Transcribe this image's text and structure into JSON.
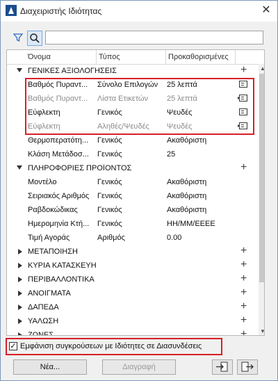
{
  "window": {
    "title": "Διαχειριστής Ιδιότητας"
  },
  "search": {
    "placeholder": ""
  },
  "columns": [
    "Όνομα",
    "Τύπος",
    "Προκαθορισμένες"
  ],
  "rows": [
    {
      "kind": "group",
      "expanded": true,
      "name": "ΓΕΝΙΚΕΣ ΑΞΙΟΛΟΓΗΣΕΙΣ"
    },
    {
      "kind": "item",
      "name": "Βαθμός Πυραντ...",
      "type": "Σύνολο Επιλογών",
      "default": "25 λεπτά",
      "dim": false,
      "icon": "list-icon"
    },
    {
      "kind": "item",
      "name": "Βαθμός Πυραντ...",
      "type": "Λίστα Ετικετών",
      "default": "25 λεπτά",
      "dim": true,
      "icon": "list-link-icon"
    },
    {
      "kind": "item",
      "name": "Εύφλεκτη",
      "type": "Γενικός",
      "default": "Ψευδές",
      "dim": false,
      "icon": "list-icon"
    },
    {
      "kind": "item",
      "name": "Εύφλεκτη",
      "type": "Αληθές/Ψευδές",
      "default": "Ψευδές",
      "dim": true,
      "icon": "list-link-icon"
    },
    {
      "kind": "item",
      "name": "Θερμοπερατότη...",
      "type": "Γενικός",
      "default": "Ακαθόριστη",
      "dim": false,
      "icon": ""
    },
    {
      "kind": "item",
      "name": "Κλάση Μετάδοσ...",
      "type": "Γενικός",
      "default": "25",
      "dim": false,
      "icon": ""
    },
    {
      "kind": "group",
      "expanded": true,
      "name": "ΠΛΗΡΟΦΟΡΙΕΣ ΠΡΟΪΟΝΤΟΣ"
    },
    {
      "kind": "item",
      "name": "Μοντέλο",
      "type": "Γενικός",
      "default": "Ακαθόριστη",
      "dim": false,
      "icon": ""
    },
    {
      "kind": "item",
      "name": "Σειριακός Αριθμός",
      "type": "Γενικός",
      "default": "Ακαθόριστη",
      "dim": false,
      "icon": ""
    },
    {
      "kind": "item",
      "name": "Ραβδοκώδικας",
      "type": "Γενικός",
      "default": "Ακαθόριστη",
      "dim": false,
      "icon": ""
    },
    {
      "kind": "item",
      "name": "Ημερομηνία Κτή...",
      "type": "Γενικός",
      "default": "HH/MM/EEEE",
      "dim": false,
      "icon": ""
    },
    {
      "kind": "item",
      "name": "Τιμή Αγοράς",
      "type": "Αριθμός",
      "default": "0.00",
      "dim": false,
      "icon": ""
    },
    {
      "kind": "group",
      "expanded": false,
      "name": "ΜΕΤΑΠΟΙΗΣΗ"
    },
    {
      "kind": "group",
      "expanded": false,
      "name": "ΚΥΡΙΑ ΚΑΤΑΣΚΕΥΗ"
    },
    {
      "kind": "group",
      "expanded": false,
      "name": "ΠΕΡΙΒΑΛΛΟΝΤΙΚΑ"
    },
    {
      "kind": "group",
      "expanded": false,
      "name": "ΑΝΟΙΓΜΑΤΑ"
    },
    {
      "kind": "group",
      "expanded": false,
      "name": "ΔΑΠΕΔΑ"
    },
    {
      "kind": "group",
      "expanded": false,
      "name": "ΥΑΛΩΣΗ"
    },
    {
      "kind": "group",
      "expanded": false,
      "name": "ΖΩΝΕΣ"
    }
  ],
  "checkbox": {
    "label": "Εμφάνιση συγκρούσεων με Ιδιότητες σε Διασυνδέσεις",
    "checked": true
  },
  "buttons": {
    "new": "Νέα...",
    "delete": "Διαγραφή"
  },
  "colors": {
    "highlight": "#d81f26",
    "search_active": "#dbe9f8"
  }
}
